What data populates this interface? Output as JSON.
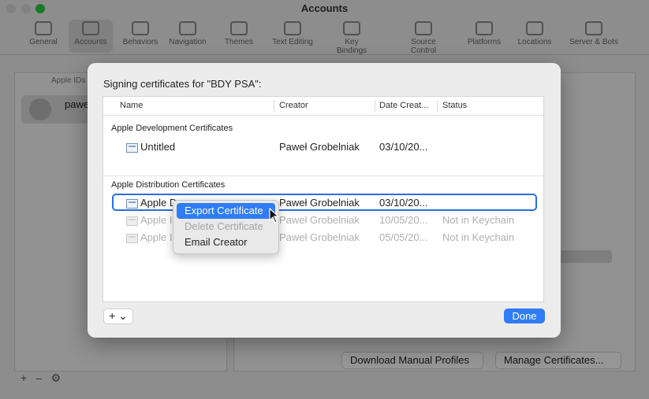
{
  "window": {
    "title": "Accounts"
  },
  "toolbar": {
    "items": [
      "General",
      "Accounts",
      "Behaviors",
      "Navigation",
      "Themes",
      "Text Editing",
      "Key Bindings",
      "Source Control",
      "Platforms",
      "Locations",
      "Server & Bots"
    ]
  },
  "sidebar": {
    "header": "Apple IDs",
    "account_name": "pawel"
  },
  "bottom_bar": {
    "add": "+",
    "remove": "–",
    "options": "⚙"
  },
  "background_buttons": {
    "download_profiles": "Download Manual Profiles",
    "manage_certificates": "Manage Certificates..."
  },
  "sheet": {
    "title": "Signing certificates for \"BDY PSA\":",
    "columns": {
      "name": "Name",
      "creator": "Creator",
      "date": "Date Creat...",
      "status": "Status"
    },
    "groups": [
      {
        "label": "Apple Development Certificates",
        "rows": [
          {
            "name": "Untitled",
            "creator": "Paweł Grobelniak",
            "date": "03/10/20...",
            "status": ""
          }
        ]
      },
      {
        "label": "Apple Distribution Certificates",
        "rows": [
          {
            "name": "Apple D",
            "creator": "Paweł Grobelniak",
            "date": "03/10/20...",
            "status": ""
          },
          {
            "name": "Apple I",
            "creator": "Paweł Grobelniak",
            "date": "10/05/20...",
            "status": "Not in Keychain"
          },
          {
            "name": "Apple I",
            "creator": "Paweł Grobelniak",
            "date": "05/05/20...",
            "status": "Not in Keychain"
          }
        ]
      }
    ],
    "add_button": "+ ⌄",
    "done_button": "Done"
  },
  "context_menu": {
    "items": [
      "Export Certificate",
      "Delete Certificate",
      "Email Creator"
    ]
  },
  "colors": {
    "accent": "#2f7cf6",
    "selection_ring": "#2a6fdb"
  }
}
